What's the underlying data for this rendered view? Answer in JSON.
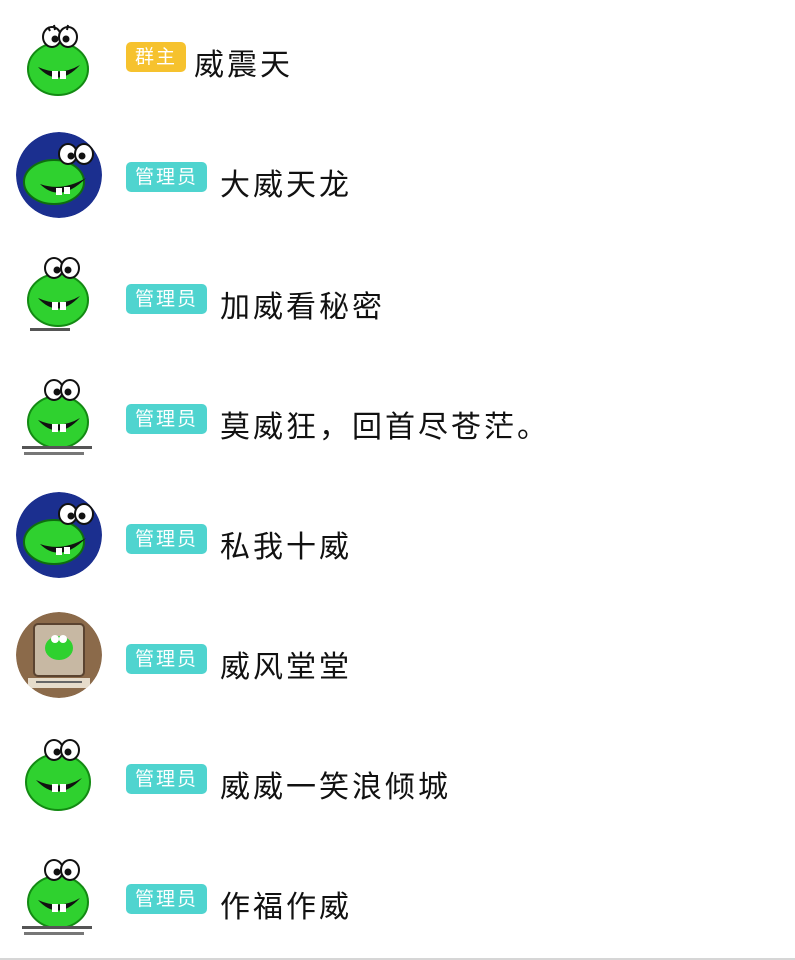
{
  "members": [
    {
      "role": "群主",
      "name": "威震天",
      "avatar": "frog-icon"
    },
    {
      "role": "管理员",
      "name": "大威天龙",
      "avatar": "frog-navy-icon"
    },
    {
      "role": "管理员",
      "name": "加威看秘密",
      "avatar": "frog-icon"
    },
    {
      "role": "管理员",
      "name": "莫威狂，回首尽苍茫。",
      "avatar": "frog-icon"
    },
    {
      "role": "管理员",
      "name": "私我十威",
      "avatar": "frog-navy-icon"
    },
    {
      "role": "管理员",
      "name": "威风堂堂",
      "avatar": "frog-photo-icon"
    },
    {
      "role": "管理员",
      "name": "威威一笑浪倾城",
      "avatar": "frog-icon"
    },
    {
      "role": "管理员",
      "name": "作福作威",
      "avatar": "frog-icon"
    }
  ],
  "colors": {
    "owner_badge": "#f6c22e",
    "admin_badge": "#4fd4cf",
    "frog_green": "#2fd12f",
    "navy_bg": "#1b2f8f"
  }
}
